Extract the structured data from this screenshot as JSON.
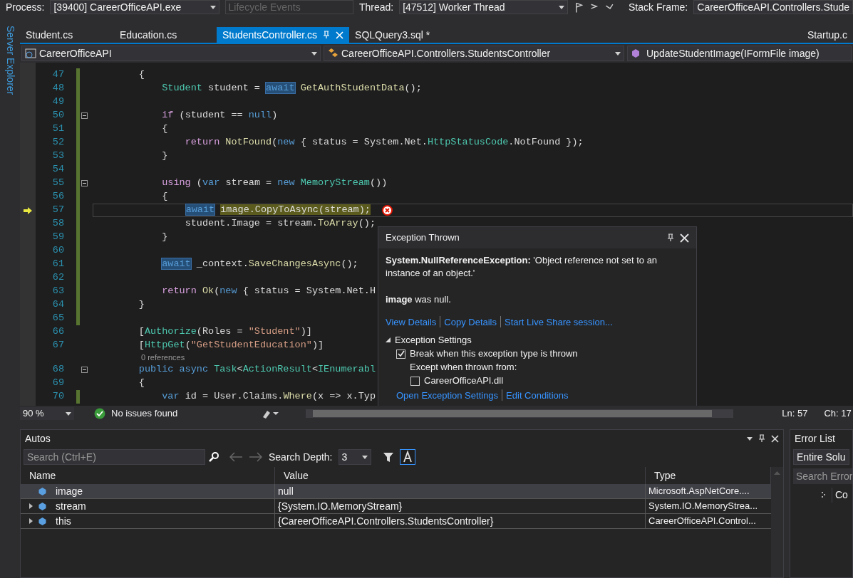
{
  "toolbar": {
    "process_label": "Process:",
    "process": "[39400] CareerOfficeAPI.exe",
    "lifecycle": {
      "label": "Lifecycle Events",
      "disabled": true
    },
    "thread_label": "Thread:",
    "thread": "[47512] Worker Thread",
    "stack_label": "Stack Frame:",
    "stack": "CareerOfficeAPI.Controllers.Stude"
  },
  "side_tab": "Server Explorer",
  "tabs": [
    {
      "label": "Student.cs",
      "selected": false
    },
    {
      "label": "Education.cs",
      "selected": false
    },
    {
      "label": "StudentsController.cs",
      "selected": true
    },
    {
      "label": "SQLQuery3.sql *",
      "selected": false
    },
    {
      "label": "Startup.c",
      "selected": false
    }
  ],
  "nav": {
    "project": "CareerOfficeAPI",
    "class": "CareerOfficeAPI.Controllers.StudentsController",
    "member": "UpdateStudentImage(IFormFile image)"
  },
  "code_lines": [
    {
      "number": "47",
      "changed": true,
      "tokens": [
        {
          "kind": "plain",
          "text": "        {"
        }
      ]
    },
    {
      "number": "48",
      "changed": true,
      "tokens": [
        {
          "kind": "type",
          "text": "            Student"
        },
        {
          "kind": "plain",
          "text": " student = "
        },
        {
          "kind": "ref",
          "text": "await"
        },
        {
          "kind": "method",
          "text": " GetAuthStudentData"
        },
        {
          "kind": "plain",
          "text": "();"
        }
      ]
    },
    {
      "number": "49",
      "changed": true
    },
    {
      "number": "50",
      "changed": true,
      "fold": true,
      "tokens": [
        {
          "kind": "control",
          "text": "            if"
        },
        {
          "kind": "plain",
          "text": " (student == "
        },
        {
          "kind": "keyword",
          "text": "null"
        },
        {
          "kind": "plain",
          "text": ")"
        }
      ]
    },
    {
      "number": "51",
      "changed": true,
      "tokens": [
        {
          "kind": "plain",
          "text": "            {"
        }
      ]
    },
    {
      "number": "52",
      "changed": true,
      "tokens": [
        {
          "kind": "control",
          "text": "                return"
        },
        {
          "kind": "method",
          "text": " NotFound"
        },
        {
          "kind": "plain",
          "text": "("
        },
        {
          "kind": "keyword",
          "text": "new"
        },
        {
          "kind": "plain",
          "text": " { status = System.Net."
        },
        {
          "kind": "type",
          "text": "HttpStatusCode"
        },
        {
          "kind": "plain",
          "text": ".NotFound });"
        }
      ]
    },
    {
      "number": "53",
      "changed": true,
      "tokens": [
        {
          "kind": "plain",
          "text": "            }"
        }
      ]
    },
    {
      "number": "54",
      "changed": true
    },
    {
      "number": "55",
      "changed": true,
      "fold": true,
      "tokens": [
        {
          "kind": "control",
          "text": "            using"
        },
        {
          "kind": "plain",
          "text": " ("
        },
        {
          "kind": "keyword",
          "text": "var"
        },
        {
          "kind": "plain",
          "text": " stream = "
        },
        {
          "kind": "keyword",
          "text": "new"
        },
        {
          "kind": "type",
          "text": " MemoryStream"
        },
        {
          "kind": "plain",
          "text": "())"
        }
      ]
    },
    {
      "number": "56",
      "changed": true,
      "tokens": [
        {
          "kind": "plain",
          "text": "            {"
        }
      ]
    },
    {
      "number": "57",
      "changed": true,
      "current": true,
      "tokens": [
        {
          "kind": "ref",
          "text": "                await"
        },
        {
          "kind": "exec",
          "text": " image.CopyToAsync(stream);"
        }
      ]
    },
    {
      "number": "58",
      "changed": true,
      "tokens": [
        {
          "kind": "plain",
          "text": "                student.Image = stream."
        },
        {
          "kind": "method",
          "text": "ToArray"
        },
        {
          "kind": "plain",
          "text": "();"
        }
      ]
    },
    {
      "number": "59",
      "changed": true,
      "tokens": [
        {
          "kind": "plain",
          "text": "            }"
        }
      ]
    },
    {
      "number": "60",
      "changed": true
    },
    {
      "number": "61",
      "changed": true,
      "tokens": [
        {
          "kind": "ref",
          "text": "            await"
        },
        {
          "kind": "plain",
          "text": " _context."
        },
        {
          "kind": "method",
          "text": "SaveChangesAsync"
        },
        {
          "kind": "plain",
          "text": "();"
        }
      ]
    },
    {
      "number": "62",
      "changed": true
    },
    {
      "number": "63",
      "changed": true,
      "tokens": [
        {
          "kind": "control",
          "text": "            return"
        },
        {
          "kind": "method",
          "text": " Ok"
        },
        {
          "kind": "plain",
          "text": "("
        },
        {
          "kind": "keyword",
          "text": "new"
        },
        {
          "kind": "plain",
          "text": " { status = System.Net.H"
        }
      ]
    },
    {
      "number": "64",
      "changed": true,
      "tokens": [
        {
          "kind": "plain",
          "text": "        }"
        }
      ]
    },
    {
      "number": "65",
      "changed": true
    },
    {
      "number": "66",
      "tokens": [
        {
          "kind": "plain",
          "text": "        ["
        },
        {
          "kind": "type",
          "text": "Authorize"
        },
        {
          "kind": "plain",
          "text": "(Roles = "
        },
        {
          "kind": "string",
          "text": "\"Student\""
        },
        {
          "kind": "plain",
          "text": ")]"
        }
      ]
    },
    {
      "number": "67",
      "tokens": [
        {
          "kind": "plain",
          "text": "        ["
        },
        {
          "kind": "type",
          "text": "HttpGet"
        },
        {
          "kind": "plain",
          "text": "("
        },
        {
          "kind": "string",
          "text": "\"GetStudentEducation\""
        },
        {
          "kind": "plain",
          "text": ")]"
        }
      ],
      "lens": "0 references"
    },
    {
      "number": "68",
      "fold": true,
      "tokens": [
        {
          "kind": "keyword",
          "text": "        public async"
        },
        {
          "kind": "type",
          "text": " Task"
        },
        {
          "kind": "plain",
          "text": "<"
        },
        {
          "kind": "type",
          "text": "ActionResult"
        },
        {
          "kind": "plain",
          "text": "<"
        },
        {
          "kind": "type",
          "text": "IEnumerabl"
        }
      ]
    },
    {
      "number": "69",
      "tokens": [
        {
          "kind": "plain",
          "text": "        {"
        }
      ]
    },
    {
      "number": "70",
      "changed": true,
      "tokens": [
        {
          "kind": "keyword",
          "text": "            var"
        },
        {
          "kind": "plain",
          "text": " id = User.Claims."
        },
        {
          "kind": "method",
          "text": "Where"
        },
        {
          "kind": "plain",
          "text": "(x => x.Typ"
        }
      ]
    }
  ],
  "exception": {
    "title": "Exception Thrown",
    "message": "**System.NullReferenceException:** 'Object reference not set to an instance of an object.'",
    "detail": "**image** was null.",
    "links": [
      "View Details",
      "Copy Details",
      "Start Live Share session..."
    ],
    "settings_title": "Exception Settings",
    "options": [
      {
        "kind": "checkbox",
        "label": "Break when this exception type is thrown",
        "checked": true
      },
      {
        "kind": "label",
        "label": "Except when thrown from:"
      },
      {
        "kind": "checkbox",
        "label": "CareerOfficeAPI.dll",
        "checked": false
      }
    ],
    "footer_links": [
      "Open Exception Settings",
      "Edit Conditions"
    ]
  },
  "status_bar": {
    "zoom": "90 %",
    "issues": "No issues found",
    "line": "Ln: 57",
    "col": "Ch: 17"
  },
  "autos": {
    "title": "Autos",
    "search_placeholder": "Search (Ctrl+E)",
    "depth_label": "Search Depth:",
    "depth": "3",
    "columns": [
      "Name",
      "Value",
      "Type"
    ],
    "rows": [
      {
        "name": "image",
        "value": "null",
        "type": "Microsoft.AspNetCore....",
        "expandable": false,
        "selected": true
      },
      {
        "name": "stream",
        "value": "{System.IO.MemoryStream}",
        "type": "System.IO.MemoryStrea...",
        "expandable": true,
        "selected": false
      },
      {
        "name": "this",
        "value": "{CareerOfficeAPI.Controllers.StudentsController}",
        "type": "CareerOfficeAPI.Control...",
        "expandable": true,
        "selected": false
      }
    ]
  },
  "error_list": {
    "title": "Error List",
    "scope": "Entire Solu",
    "search_placeholder": "Search Error",
    "column": "Co"
  }
}
